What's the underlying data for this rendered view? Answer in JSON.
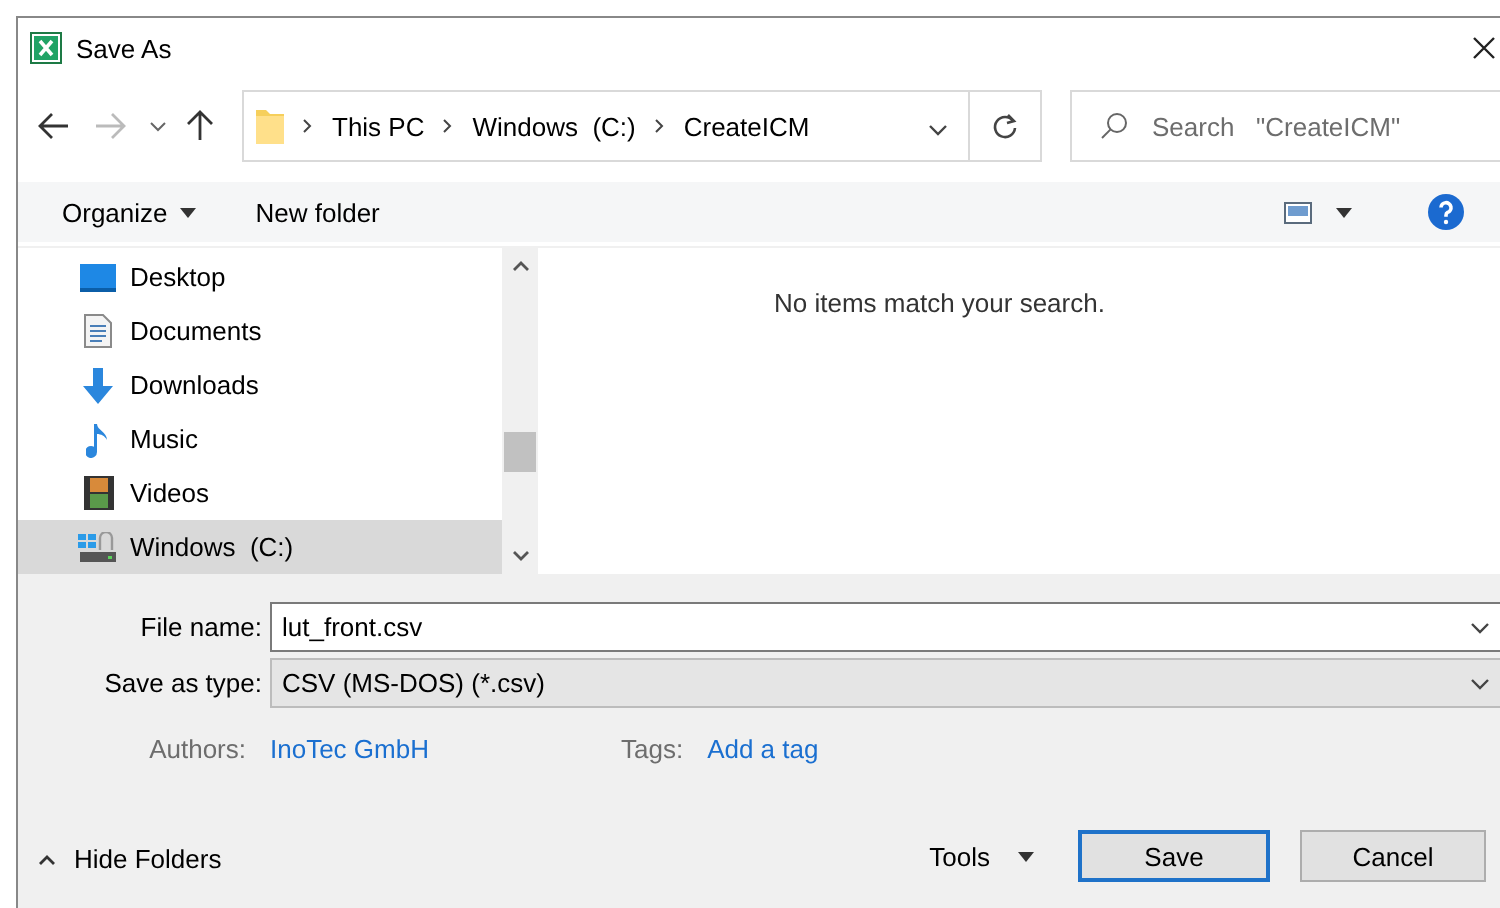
{
  "window": {
    "title": "Save As"
  },
  "address_bar": {
    "breadcrumbs": [
      "This PC",
      "Windows  (C:)",
      "CreateICM"
    ]
  },
  "search": {
    "placeholder": "Search   \"CreateICM\""
  },
  "toolbar": {
    "organize": "Organize",
    "new_folder": "New folder"
  },
  "nav_pane": {
    "items": [
      {
        "label": "Desktop",
        "kind": "desktop",
        "selected": false
      },
      {
        "label": "Documents",
        "kind": "documents",
        "selected": false
      },
      {
        "label": "Downloads",
        "kind": "downloads",
        "selected": false
      },
      {
        "label": "Music",
        "kind": "music",
        "selected": false
      },
      {
        "label": "Videos",
        "kind": "videos",
        "selected": false
      },
      {
        "label": "Windows  (C:)",
        "kind": "drive",
        "selected": true
      }
    ]
  },
  "content": {
    "empty_message": "No items match your search."
  },
  "form": {
    "file_name": {
      "label": "File name:",
      "value": "lut_front.csv"
    },
    "save_as_type": {
      "label": "Save as type:",
      "value": "CSV (MS-DOS) (*.csv)"
    },
    "authors": {
      "label": "Authors:",
      "value": "InoTec GmbH"
    },
    "tags": {
      "label": "Tags:",
      "value": "Add a tag"
    }
  },
  "footer": {
    "hide_folders": "Hide Folders",
    "tools": "Tools",
    "save": "Save",
    "cancel": "Cancel"
  }
}
